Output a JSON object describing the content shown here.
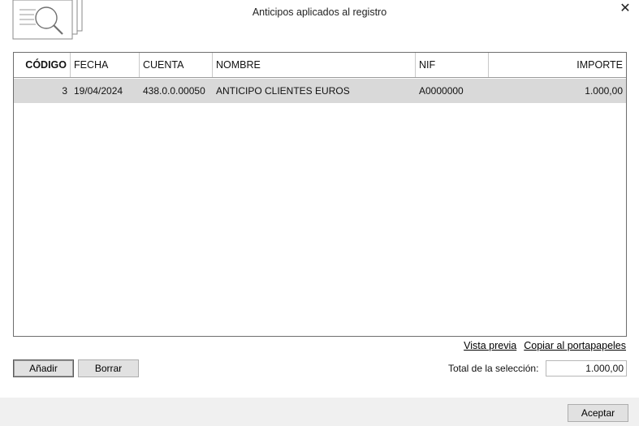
{
  "window": {
    "title": "Anticipos aplicados al registro",
    "close_icon": "close-icon"
  },
  "grid": {
    "headers": [
      "CÓDIGO",
      "FECHA",
      "CUENTA",
      "NOMBRE",
      "NIF",
      "IMPORTE"
    ],
    "rows": [
      {
        "codigo": "3",
        "fecha": "19/04/2024",
        "cuenta": "438.0.0.00050",
        "nombre": "ANTICIPO CLIENTES EUROS",
        "nif": "A0000000",
        "importe": "1.000,00"
      }
    ]
  },
  "links": {
    "preview": "Vista previa",
    "copy": "Copiar al portapapeles"
  },
  "buttons": {
    "add": "Añadir",
    "delete": "Borrar",
    "accept": "Aceptar"
  },
  "total": {
    "label": "Total de la selección:",
    "value": "1.000,00"
  },
  "colors": {
    "selected_row": "#d9d9d9",
    "button_bg": "#e1e1e1",
    "footer_bg": "#f0f0f0"
  }
}
